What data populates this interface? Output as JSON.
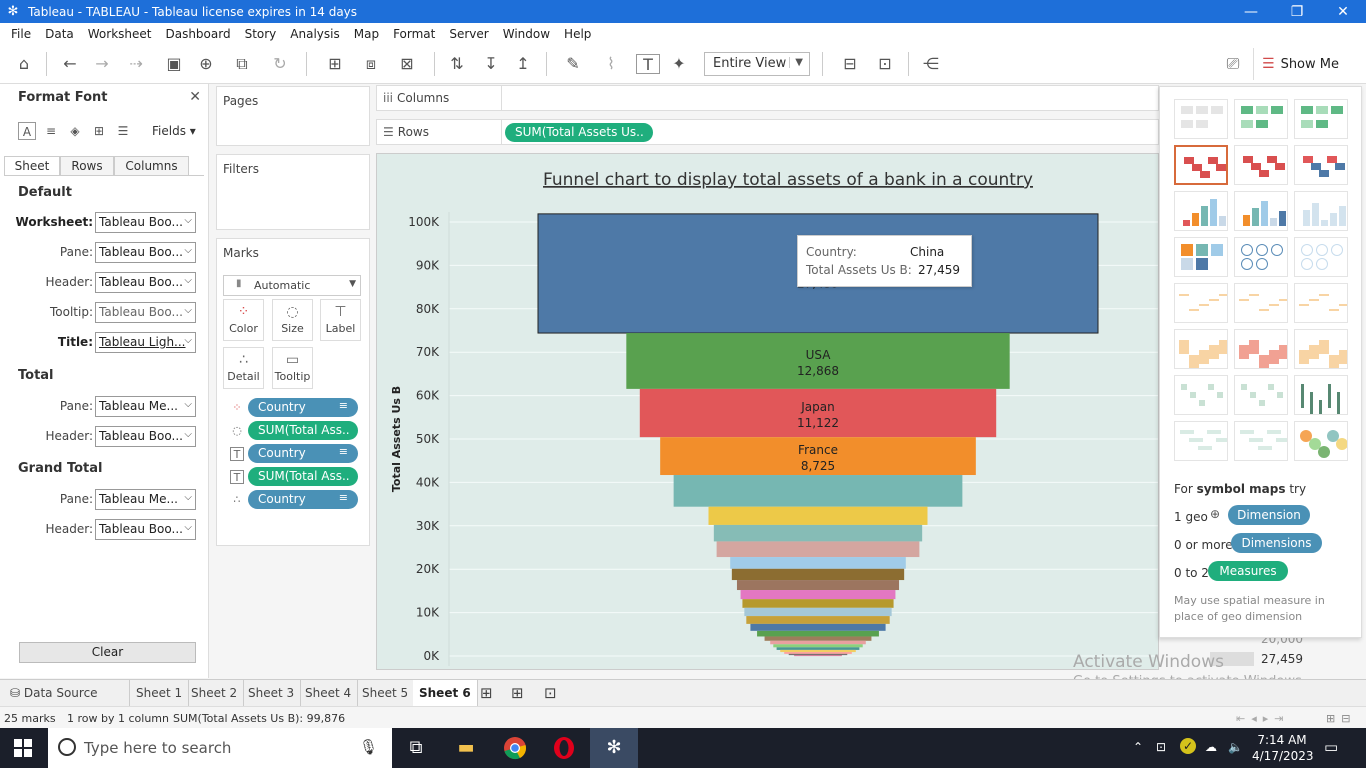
{
  "window": {
    "title": "Tableau - TABLEAU - Tableau license expires in 14 days",
    "minimize": "—",
    "restore": "❐",
    "close": "✕"
  },
  "menu": [
    "File",
    "Data",
    "Worksheet",
    "Dashboard",
    "Story",
    "Analysis",
    "Map",
    "Format",
    "Server",
    "Window",
    "Help"
  ],
  "toolbar": {
    "view_select": "Entire View",
    "show_me": "Show Me"
  },
  "format_pane": {
    "title": "Format Font",
    "fields": "Fields",
    "tabs": [
      "Sheet",
      "Rows",
      "Columns"
    ],
    "sections": {
      "default": "Default",
      "total": "Total",
      "grand_total": "Grand Total"
    },
    "default_rows": [
      {
        "label": "Worksheet:",
        "value": "Tableau Boo..."
      },
      {
        "label": "Pane:",
        "value": "Tableau Boo..."
      },
      {
        "label": "Header:",
        "value": "Tableau Boo..."
      },
      {
        "label": "Tooltip:",
        "value": "Tableau Boo..."
      },
      {
        "label": "Title:",
        "value": "Tableau Ligh..."
      }
    ],
    "total_rows": [
      {
        "label": "Pane:",
        "value": "Tableau Me..."
      },
      {
        "label": "Header:",
        "value": "Tableau Boo..."
      }
    ],
    "grand_total_rows": [
      {
        "label": "Pane:",
        "value": "Tableau Me..."
      },
      {
        "label": "Header:",
        "value": "Tableau Boo..."
      }
    ],
    "clear": "Clear"
  },
  "cards": {
    "pages": "Pages",
    "filters": "Filters",
    "marks": "Marks",
    "mark_type": "Automatic",
    "buttons": [
      "Color",
      "Size",
      "Label",
      "Detail",
      "Tooltip"
    ],
    "pills": [
      {
        "text": "Country",
        "kind": "blue"
      },
      {
        "text": "SUM(Total Ass..",
        "kind": "green"
      },
      {
        "text": "Country",
        "kind": "blue"
      },
      {
        "text": "SUM(Total Ass..",
        "kind": "green"
      },
      {
        "text": "Country",
        "kind": "blue"
      }
    ]
  },
  "shelves": {
    "columns": "Columns",
    "rows": "Rows",
    "rows_pill": "SUM(Total Assets Us.."
  },
  "chart_data": {
    "type": "bar",
    "title": "Funnel chart to display total assets of a bank in a country",
    "ylabel": "Total Assets Us B",
    "ylim": [
      0,
      100000
    ],
    "yticks": [
      "0K",
      "10K",
      "20K",
      "30K",
      "40K",
      "50K",
      "60K",
      "70K",
      "80K",
      "90K",
      "100K"
    ],
    "segments": [
      {
        "country": "China",
        "value": 27459,
        "label": "27,459",
        "color": "#4e79a7"
      },
      {
        "country": "USA",
        "value": 12868,
        "label": "12,868",
        "color": "#59a14f"
      },
      {
        "country": "Japan",
        "value": 11122,
        "label": "11,122",
        "color": "#e15759"
      },
      {
        "country": "France",
        "value": 8725,
        "label": "8,725",
        "color": "#f28e2b"
      },
      {
        "country": "",
        "value": 7300,
        "label": "",
        "color": "#76b7b2"
      },
      {
        "country": "",
        "value": 4200,
        "label": "",
        "color": "#edc948"
      },
      {
        "country": "",
        "value": 3800,
        "label": "",
        "color": "#86bcb6"
      },
      {
        "country": "",
        "value": 3600,
        "label": "",
        "color": "#d4a6a0"
      },
      {
        "country": "",
        "value": 2700,
        "label": "",
        "color": "#a0cbe8"
      },
      {
        "country": "",
        "value": 2600,
        "label": "",
        "color": "#8c6d31"
      },
      {
        "country": "",
        "value": 2300,
        "label": "",
        "color": "#9c755f"
      },
      {
        "country": "",
        "value": 2100,
        "label": "",
        "color": "#e377c2"
      },
      {
        "country": "",
        "value": 2000,
        "label": "",
        "color": "#b6992d"
      },
      {
        "country": "",
        "value": 1900,
        "label": "",
        "color": "#a5c8d8"
      },
      {
        "country": "",
        "value": 1800,
        "label": "",
        "color": "#c6a13b"
      },
      {
        "country": "",
        "value": 1600,
        "label": "",
        "color": "#4e79a7"
      },
      {
        "country": "",
        "value": 1300,
        "label": "",
        "color": "#59a14f"
      },
      {
        "country": "",
        "value": 1000,
        "label": "",
        "color": "#9e7d5c"
      },
      {
        "country": "",
        "value": 800,
        "label": "",
        "color": "#e8a0a0"
      },
      {
        "country": "",
        "value": 700,
        "label": "",
        "color": "#8cd17d"
      },
      {
        "country": "",
        "value": 600,
        "label": "",
        "color": "#499894"
      },
      {
        "country": "",
        "value": 500,
        "label": "",
        "color": "#f1ce63"
      },
      {
        "country": "",
        "value": 400,
        "label": "",
        "color": "#ff9d9a"
      },
      {
        "country": "",
        "value": 300,
        "label": "",
        "color": "#79706e"
      },
      {
        "country": "",
        "value": 200,
        "label": "",
        "color": "#d37295"
      }
    ]
  },
  "tooltip": {
    "country_label": "Country:",
    "country_value": "China",
    "assets_label": "Total Assets Us B:",
    "assets_value": "27,459"
  },
  "show_me": {
    "hint_prefix": "For ",
    "hint_bold": "symbol maps",
    "hint_suffix": " try",
    "req1_label": "1 geo",
    "req1_pill": "Dimension",
    "req2_label": "0 or more",
    "req2_pill": "Dimensions",
    "req3_label": "0 to 2",
    "req3_pill": "Measures",
    "note": "May use spatial measure in place of geo dimension"
  },
  "legend_remnant": {
    "top": "20,000",
    "value": "27,459"
  },
  "watermark": {
    "line1": "Activate Windows",
    "line2": "Go to Settings to activate Windows."
  },
  "sheet_tabs": {
    "data_source": "Data Source",
    "sheets": [
      "Sheet 1",
      "Sheet 2",
      "Sheet 3",
      "Sheet 4",
      "Sheet 5",
      "Sheet 6"
    ],
    "active": "Sheet 6"
  },
  "status": {
    "marks": "25 marks",
    "rows_cols": "1 row by 1 column",
    "sum": "SUM(Total Assets Us B): 99,876"
  },
  "taskbar": {
    "search_placeholder": "Type here to search",
    "time": "7:14 AM",
    "date": "4/17/2023"
  },
  "colors": {
    "title_bar": "#1e6fd9",
    "pill_blue": "#4a91b6",
    "pill_green": "#1fae7d",
    "viz_bg": "#dfece9"
  }
}
